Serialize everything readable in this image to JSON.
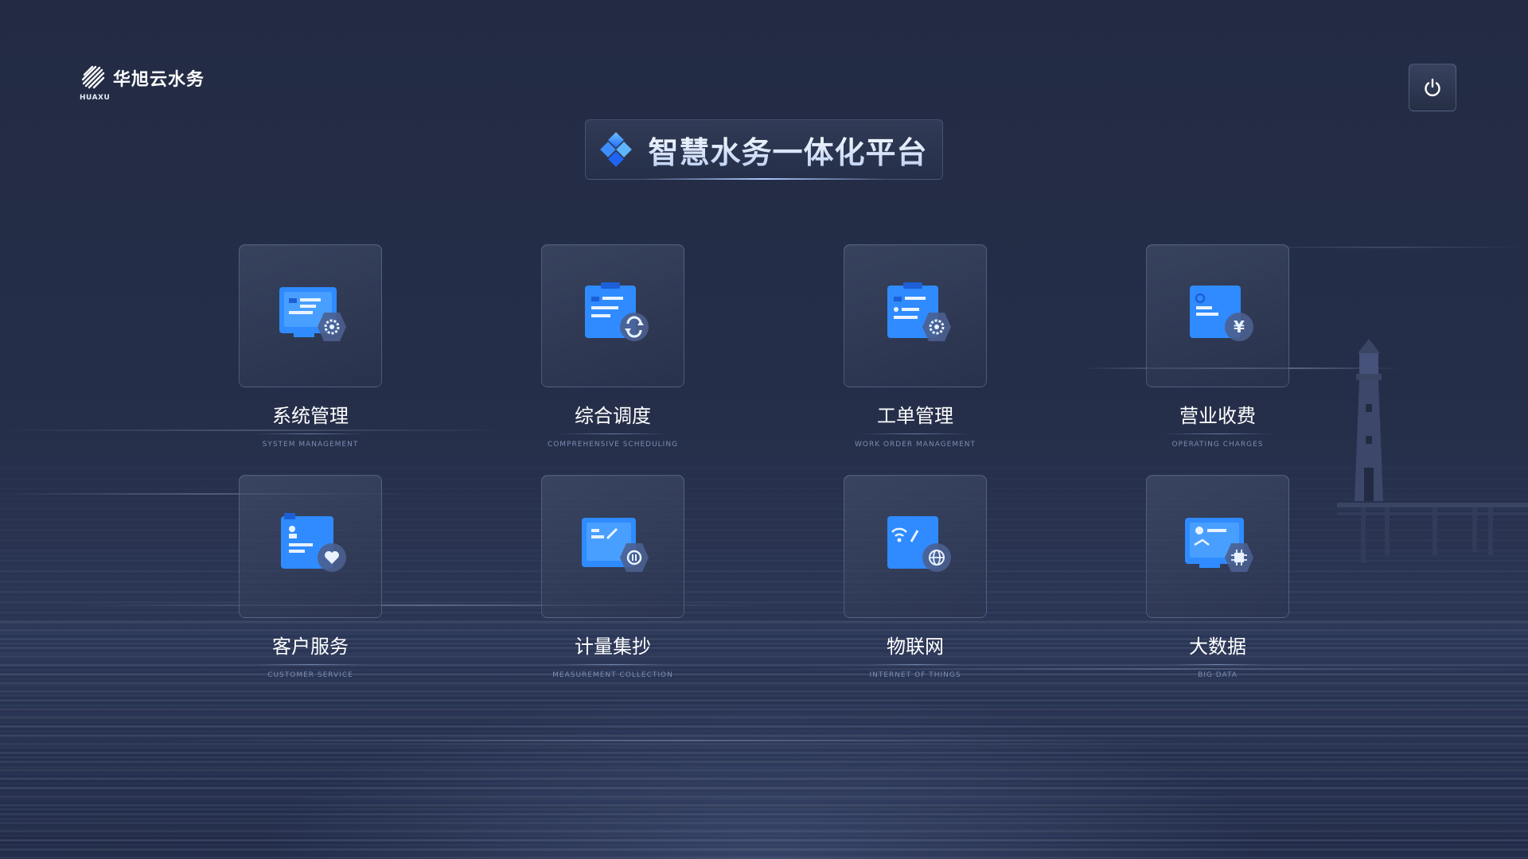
{
  "brand": {
    "name": "华旭云水务",
    "sub": "HUAXU"
  },
  "title": "智慧水务一体化平台",
  "modules": [
    {
      "label": "系统管理",
      "sub": "SYSTEM MANAGEMENT",
      "icon": "monitor-gear-icon"
    },
    {
      "label": "综合调度",
      "sub": "COMPREHENSIVE SCHEDULING",
      "icon": "clipboard-sync-icon"
    },
    {
      "label": "工单管理",
      "sub": "WORK ORDER MANAGEMENT",
      "icon": "clipboard-gear-icon"
    },
    {
      "label": "营业收费",
      "sub": "OPERATING CHARGES",
      "icon": "document-yen-icon"
    },
    {
      "label": "客户服务",
      "sub": "CUSTOMER SERVICE",
      "icon": "document-heart-icon"
    },
    {
      "label": "计量集抄",
      "sub": "MEASUREMENT COLLECTION",
      "icon": "document-meter-icon"
    },
    {
      "label": "物联网",
      "sub": "INTERNET OF THINGS",
      "icon": "device-globe-icon"
    },
    {
      "label": "大数据",
      "sub": "BIG DATA",
      "icon": "monitor-chip-icon"
    }
  ],
  "colors": {
    "background": "#232b44",
    "accent": "#2f8bff",
    "accent_light": "#5fb0ff"
  }
}
